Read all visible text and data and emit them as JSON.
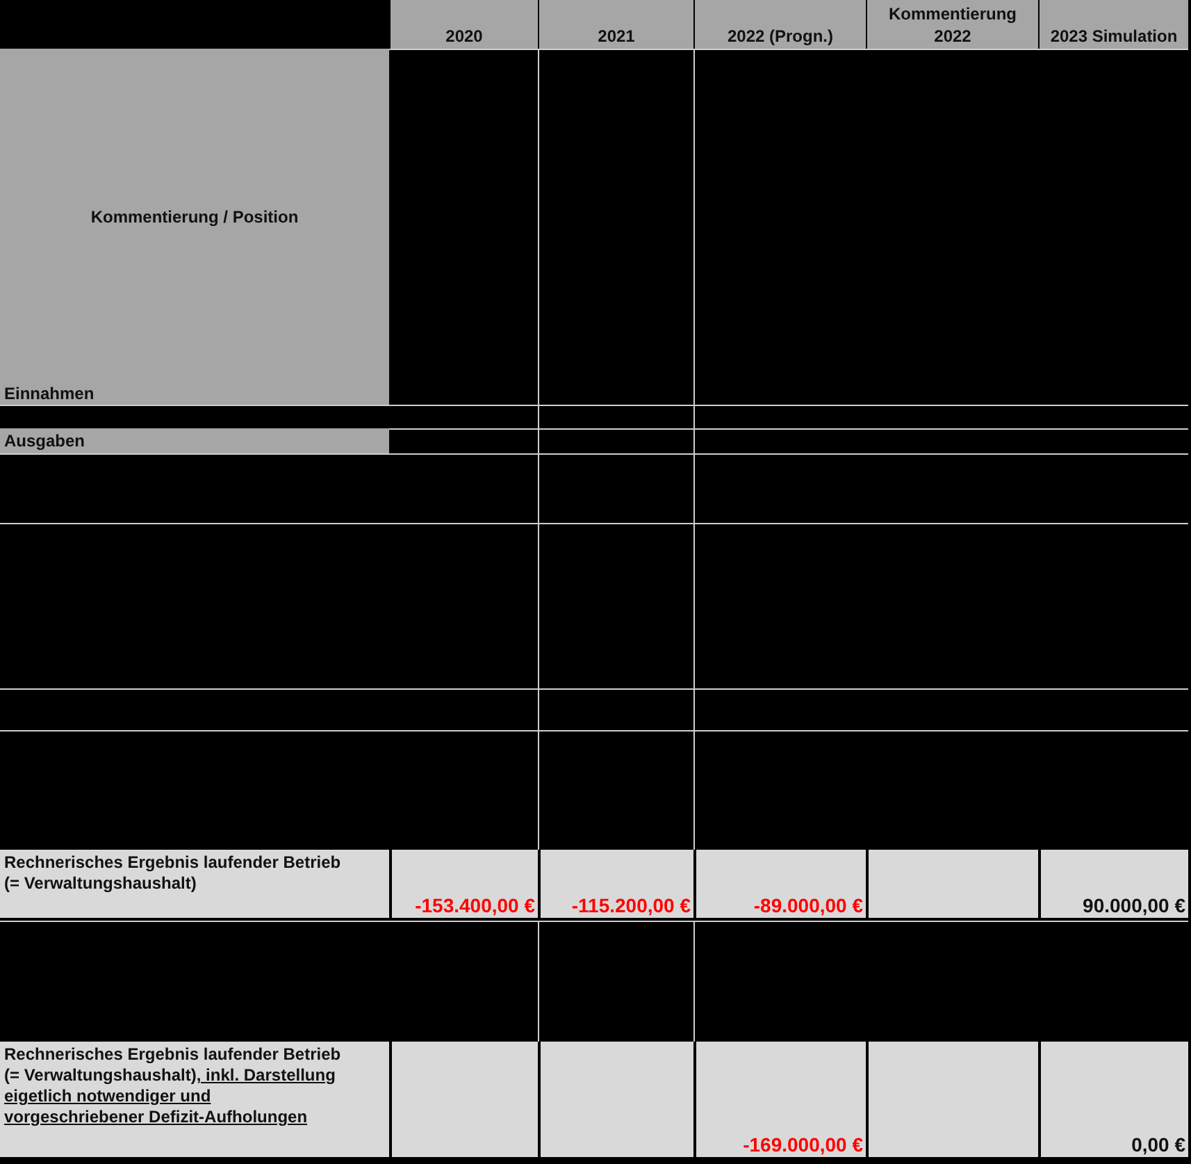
{
  "table": {
    "columns": [
      "2020",
      "2021",
      "2022 (Progn.)",
      "Kommentierung 2022",
      "2023 Simulation"
    ],
    "rows": [
      {
        "kind": "intro",
        "heading": "Kommentierung / Position",
        "section": "Einnahmen"
      },
      {
        "kind": "blank"
      },
      {
        "kind": "section",
        "label": "Ausgaben"
      },
      {
        "kind": "blank"
      },
      {
        "kind": "blank"
      },
      {
        "kind": "blank"
      },
      {
        "kind": "blank"
      },
      {
        "kind": "result",
        "label_parts": [
          {
            "text": "Rechnerisches Ergebnis laufender Betrieb (= Verwaltungshaushalt)",
            "underlined": false
          }
        ],
        "values": [
          {
            "text": "-153.400,00 €",
            "negative": true
          },
          {
            "text": "-115.200,00 €",
            "negative": true
          },
          {
            "text": "-89.000,00 €",
            "negative": true
          },
          {
            "kind": "empty"
          },
          {
            "text": "90.000,00 €",
            "negative": false
          }
        ]
      },
      {
        "kind": "blank"
      },
      {
        "kind": "result",
        "label_parts": [
          {
            "text": "Rechnerisches Ergebnis laufender Betrieb (= Verwaltungshaushalt)",
            "underlined": false
          },
          {
            "text": ", inkl. Darstellung  eigetlich notwendiger und  vorgeschriebener Defizit-Aufholungen",
            "underlined": true
          }
        ],
        "values": [
          {
            "kind": "empty"
          },
          {
            "kind": "empty"
          },
          {
            "text": "-169.000,00 €",
            "negative": true
          },
          {
            "kind": "empty"
          },
          {
            "text": "0,00 €",
            "negative": false
          }
        ]
      }
    ]
  }
}
